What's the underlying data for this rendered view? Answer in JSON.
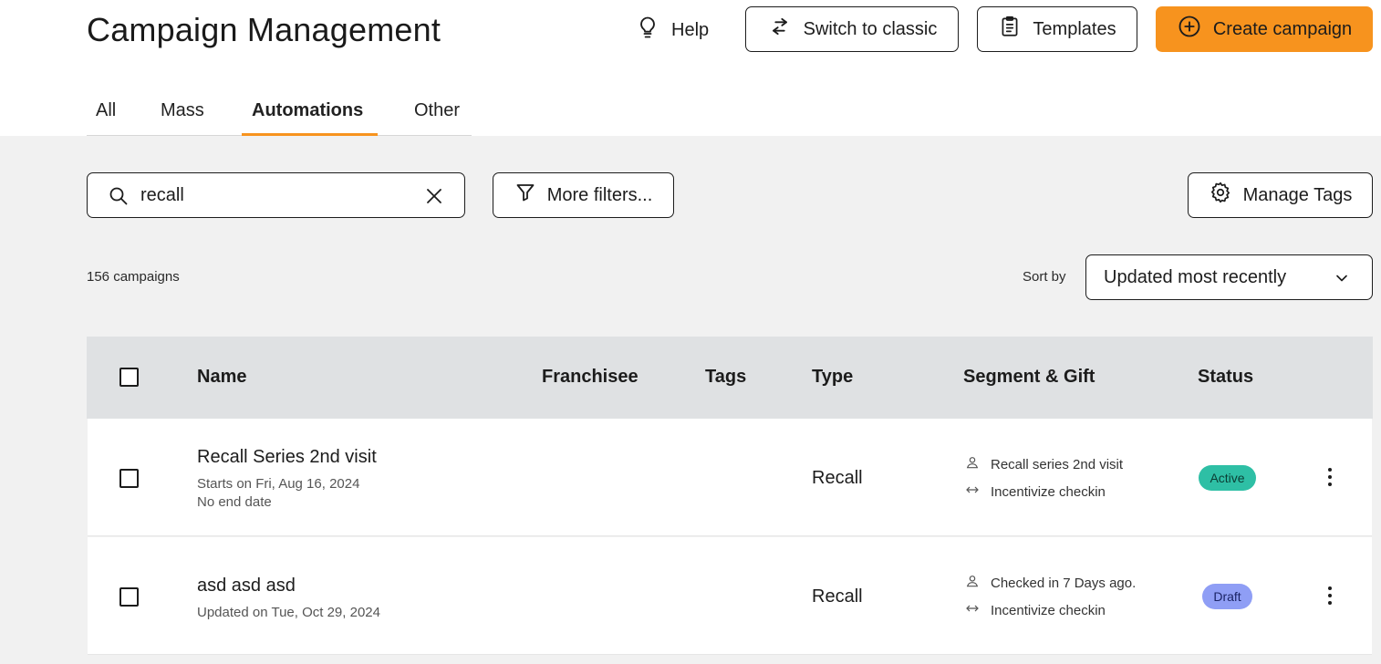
{
  "header": {
    "title": "Campaign Management",
    "help_label": "Help",
    "switch_label": "Switch to classic",
    "templates_label": "Templates",
    "create_label": "Create campaign"
  },
  "tabs": [
    {
      "label": "All"
    },
    {
      "label": "Mass"
    },
    {
      "label": "Automations",
      "active": true
    },
    {
      "label": "Other"
    }
  ],
  "toolbar": {
    "search_value": "recall",
    "filters_label": "More filters...",
    "manage_tags_label": "Manage Tags"
  },
  "list_meta": {
    "count_text": "156 campaigns",
    "sort_label": "Sort by",
    "sort_value": "Updated most recently"
  },
  "table": {
    "columns": [
      "Name",
      "Franchisee",
      "Tags",
      "Type",
      "Segment & Gift",
      "Status"
    ],
    "rows": [
      {
        "name": "Recall Series 2nd visit",
        "sub1": "Starts on Fri, Aug 16, 2024",
        "sub2": "No end date",
        "type": "Recall",
        "segment": "Recall series 2nd visit",
        "gift": "Incentivize checkin",
        "status": "Active"
      },
      {
        "name": "asd asd asd",
        "sub1": "Updated on Tue, Oct 29, 2024",
        "type": "Recall",
        "segment": "Checked in 7 Days ago.",
        "gift": "Incentivize checkin",
        "status": "Draft"
      }
    ]
  },
  "colors": {
    "accent": "#f7931e",
    "active_badge": "#2ebfa5",
    "draft_badge": "#8f9ef5",
    "header_row": "#dfe1e3",
    "page_bg": "#f1f1f1"
  }
}
